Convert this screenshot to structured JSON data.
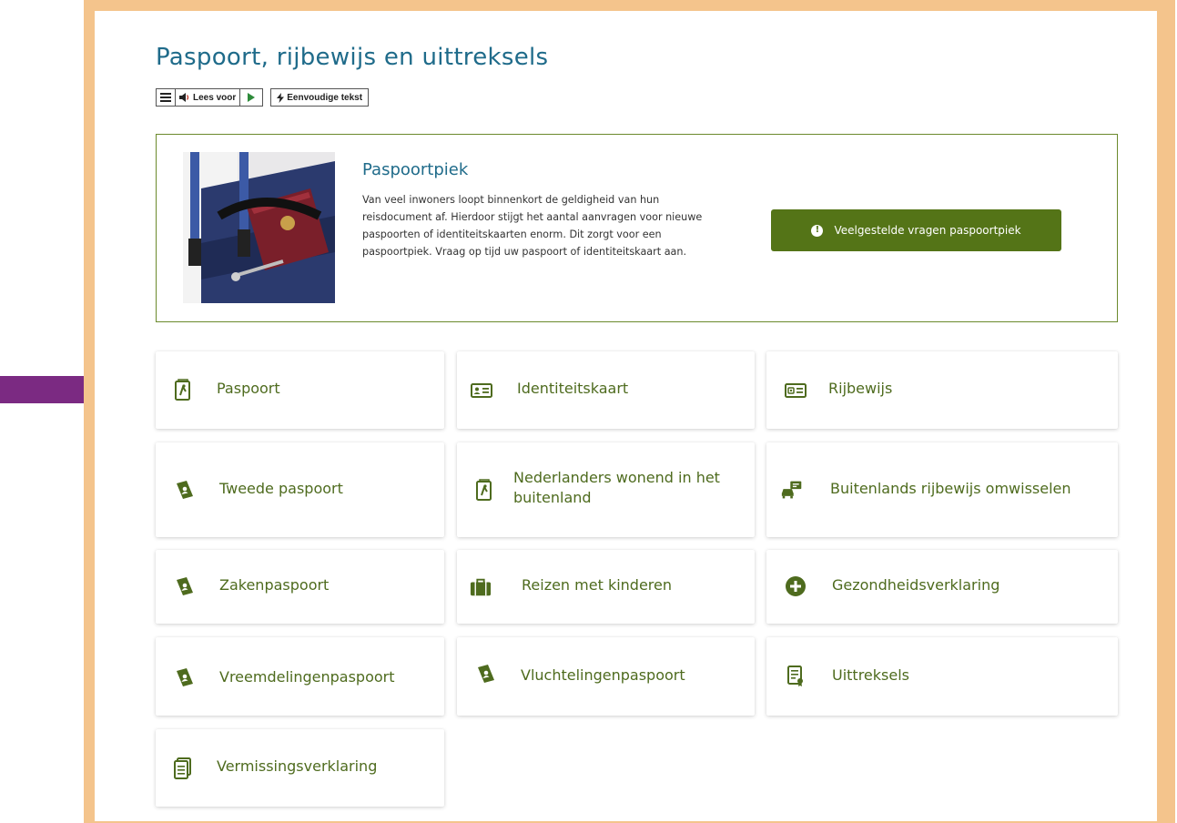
{
  "page": {
    "title": "Paspoort, rijbewijs en uittreksels"
  },
  "toolbar": {
    "read_aloud_label": "Lees voor",
    "simple_text_label": "Eenvoudige tekst"
  },
  "banner": {
    "heading": "Paspoortpiek",
    "text": "Van veel inwoners loopt binnenkort de geldigheid van hun reisdocument af. Hierdoor stijgt het aantal aanvragen voor nieuwe paspoorten of identiteitskaarten enorm. Dit zorgt voor een paspoortpiek. Vraag op tijd uw paspoort of identiteitskaart aan.",
    "button_label": "Veelgestelde vragen paspoortpiek"
  },
  "tiles": [
    {
      "label": "Paspoort",
      "icon": "passport-icon"
    },
    {
      "label": "Identiteitskaart",
      "icon": "id-card-icon"
    },
    {
      "label": "Rijbewijs",
      "icon": "driving-license-icon"
    },
    {
      "label": "Tweede paspoort",
      "icon": "passport-book-icon"
    },
    {
      "label": "Nederlanders wonend in het buitenland",
      "icon": "passport-icon"
    },
    {
      "label": "Buitenlands rijbewijs omwisselen",
      "icon": "car-license-icon"
    },
    {
      "label": "Zakenpaspoort",
      "icon": "passport-book-icon"
    },
    {
      "label": "Reizen met kinderen",
      "icon": "suitcase-icon"
    },
    {
      "label": "Gezondheidsverklaring",
      "icon": "plus-circle-icon"
    },
    {
      "label": "Vreemdelingenpaspoort",
      "icon": "passport-book-icon"
    },
    {
      "label": "Vluchtelingenpaspoort",
      "icon": "passport-book-icon"
    },
    {
      "label": "Uittreksels",
      "icon": "certificate-icon"
    },
    {
      "label": "Vermissingsverklaring",
      "icon": "document-stack-icon"
    }
  ],
  "colors": {
    "frame": "#f4c48c",
    "title": "#1f6b8a",
    "accent_green": "#547417",
    "tile_text": "#4e6b1e",
    "arrow": "#7b2a82"
  }
}
